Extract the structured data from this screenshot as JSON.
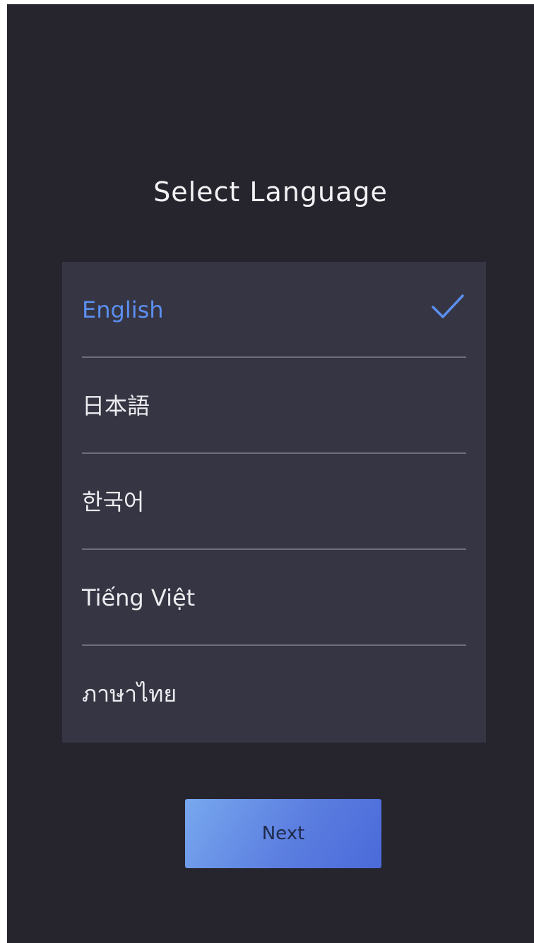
{
  "title": "Select Language",
  "languages": [
    {
      "label": "English",
      "selected": true
    },
    {
      "label": "日本語",
      "selected": false
    },
    {
      "label": "한국어",
      "selected": false
    },
    {
      "label": "Tiếng Việt",
      "selected": false
    },
    {
      "label": "ภาษาไทย",
      "selected": false
    }
  ],
  "next_label": "Next",
  "colors": {
    "background": "#26252e",
    "panel": "#363543",
    "accent": "#5b8ff0",
    "text": "#ececf0"
  },
  "icons": {
    "selected": "checkmark-icon"
  }
}
